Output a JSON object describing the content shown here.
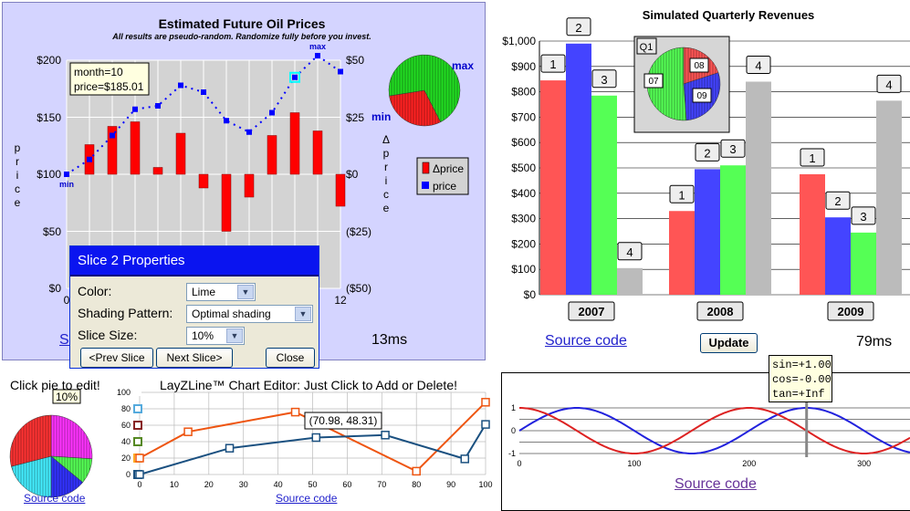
{
  "oil_panel": {
    "title": "Estimated Future Oil Prices",
    "subtitle": "All results are pseudo-random. Randomize fully before you invest.",
    "y_left_label": "price",
    "y_right_label": "Δprice",
    "y_left_ticks": [
      "$200",
      "$150",
      "$100",
      "$50",
      "$0"
    ],
    "y_right_ticks": [
      "$50",
      "$25",
      "$0",
      "($25)",
      "($50)"
    ],
    "x_tick_first": "0",
    "x_tick_last": "12",
    "tooltip_line1": "month=10",
    "tooltip_line2": "price=$185.01",
    "min_label": "min",
    "max_label": "max",
    "pie_max_label": "max",
    "pie_min_label": "min",
    "legend_dprice": "Δprice",
    "legend_price": "price",
    "timing": "13ms",
    "source_link_fragment": "So",
    "colors": {
      "bg": "#d4d4ff",
      "plot": "#d3d3d3",
      "bar": "#ff0000",
      "line": "#0000ff"
    }
  },
  "slice_dialog": {
    "title": "Slice 2 Properties",
    "color_label": "Color:",
    "color_value": "Lime",
    "shading_label": "Shading Pattern:",
    "shading_value": "Optimal shading",
    "size_label": "Slice Size:",
    "size_value": "10%",
    "prev_button": "<Prev Slice",
    "next_button": "Next Slice>",
    "close_button": "Close"
  },
  "revenue_panel": {
    "title": "Simulated Quarterly Revenues",
    "y_ticks": [
      "$1,000",
      "$900",
      "$800",
      "$700",
      "$600",
      "$500",
      "$400",
      "$300",
      "$200",
      "$100",
      "$0"
    ],
    "inset_label": "Q1",
    "inset_pie_labels": [
      "08",
      "09",
      "07"
    ],
    "source_link": "Source code",
    "update_button": "Update",
    "timing": "79ms"
  },
  "pie_editor": {
    "title": "Click pie to edit!",
    "callout": "10%",
    "source_link": "Source code"
  },
  "lazyline_panel": {
    "title": "LayZLine™ Chart Editor: Just Click to Add or Delete!",
    "tooltip": "(70.98, 48.31)",
    "source_link": "Source code"
  },
  "trig_panel": {
    "readout_sin": "sin=+1.00",
    "readout_cos": "cos=-0.00",
    "readout_tan": "tan=+Inf",
    "source_link": "Source code"
  },
  "chart_data": [
    {
      "type": "bar",
      "title": "Estimated Future Oil Prices",
      "subtitle": "All results are pseudo-random. Randomize fully before you invest.",
      "x": [
        0,
        1,
        2,
        3,
        4,
        5,
        6,
        7,
        8,
        9,
        10,
        11,
        12
      ],
      "series": [
        {
          "name": "Δprice",
          "axis": "right",
          "values": [
            0,
            13,
            21,
            23,
            3,
            18,
            -6,
            -25,
            -10,
            17,
            27,
            19,
            -14
          ]
        },
        {
          "name": "price",
          "axis": "left",
          "values": [
            100,
            113,
            134,
            157,
            160,
            178,
            172,
            147,
            137,
            154,
            185,
            204,
            190
          ]
        }
      ],
      "ylabel": "price",
      "y2label": "Δprice",
      "ylim": [
        0,
        200
      ],
      "y2lim": [
        -50,
        50
      ],
      "xlim": [
        0,
        12
      ],
      "grid": true,
      "legend": "right"
    },
    {
      "type": "pie",
      "values": [
        30,
        70
      ],
      "colors": [
        "#ff2222",
        "#22dd22"
      ]
    },
    {
      "type": "bar",
      "title": "Simulated Quarterly Revenues",
      "categories": [
        "2007",
        "2008",
        "2009"
      ],
      "series": [
        {
          "name": "1",
          "color": "#ff5555",
          "values": [
            845,
            330,
            475
          ]
        },
        {
          "name": "2",
          "color": "#4444ff",
          "values": [
            990,
            495,
            305
          ]
        },
        {
          "name": "3",
          "color": "#55ff55",
          "values": [
            785,
            510,
            245
          ]
        },
        {
          "name": "4",
          "color": "#bbbbbb",
          "values": [
            105,
            840,
            765
          ]
        }
      ],
      "ylim": [
        0,
        1000
      ],
      "grid": true
    },
    {
      "type": "pie",
      "title": "Q1",
      "categories": [
        "07",
        "08",
        "09"
      ],
      "values": [
        845,
        330,
        475
      ],
      "colors": [
        "#55ff55",
        "#ff5555",
        "#4444ff"
      ]
    },
    {
      "type": "pie",
      "title": "Click pie to edit!",
      "values": [
        26,
        10,
        14,
        21,
        29
      ],
      "colors": [
        "#ff33ff",
        "#55ff55",
        "#3333ff",
        "#44eeff",
        "#ff3333"
      ]
    },
    {
      "type": "line",
      "title": "LayZLine™ Chart Editor: Just Click to Add or Delete!",
      "xlim": [
        0,
        100
      ],
      "ylim": [
        0,
        100
      ],
      "x_ticks": [
        0,
        10,
        20,
        30,
        40,
        50,
        60,
        70,
        80,
        90,
        100
      ],
      "y_ticks": [
        0,
        20,
        40,
        60,
        80,
        100
      ],
      "series": [
        {
          "name": "orange",
          "color": "#ee5511",
          "points": [
            [
              0,
              20
            ],
            [
              14,
              52
            ],
            [
              45,
              76
            ],
            [
              80,
              4
            ],
            [
              100,
              88
            ]
          ]
        },
        {
          "name": "blue",
          "color": "#1a5080",
          "points": [
            [
              0,
              0
            ],
            [
              26,
              32
            ],
            [
              51,
              45
            ],
            [
              71,
              48
            ],
            [
              94,
              19
            ],
            [
              100,
              61
            ]
          ]
        }
      ]
    },
    {
      "type": "line",
      "xlim": [
        0,
        340
      ],
      "ylim": [
        -1,
        1
      ],
      "x_ticks": [
        0,
        100,
        200,
        300
      ],
      "y_ticks": [
        1,
        0,
        -1
      ],
      "series": [
        {
          "name": "sin",
          "color": "#2222dd",
          "function": "sin(x * 2π / 200)"
        },
        {
          "name": "cos",
          "color": "#dd2222",
          "function": "cos(x * 2π / 200)"
        }
      ],
      "cursor_x": 250,
      "grid": true
    }
  ]
}
